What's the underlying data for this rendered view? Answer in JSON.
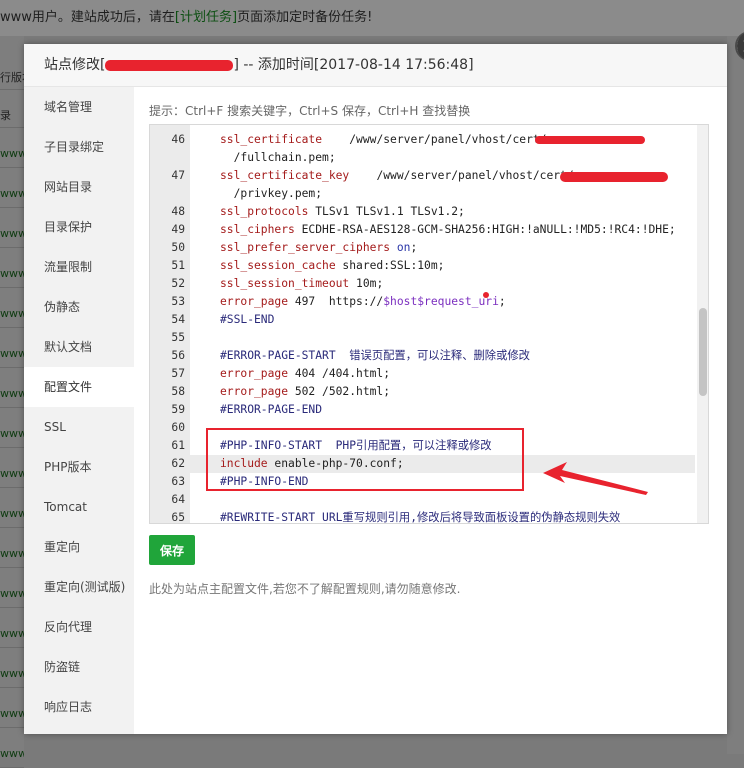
{
  "background": {
    "top_text_before": "www用户。建站成功后，请在",
    "top_link": "[计划任务]",
    "top_text_after": "页面添加定时备份任务!",
    "row_fragments": [
      "行版本",
      "录",
      "www/w",
      "www/w",
      "www/w",
      "www/w",
      "www/w",
      "www/w",
      "www/w",
      "www/w",
      "www/w",
      "www/w",
      "www/w",
      "www/w",
      "www/w",
      "www/w",
      "www/w",
      "www/w"
    ]
  },
  "dialog": {
    "title_prefix": "站点修改[",
    "title_suffix": "] -- 添加时间[2017-08-14 17:56:48]",
    "close_icon": "close-icon"
  },
  "sidebar": {
    "items": [
      {
        "label": "域名管理"
      },
      {
        "label": "子目录绑定"
      },
      {
        "label": "网站目录"
      },
      {
        "label": "目录保护"
      },
      {
        "label": "流量限制"
      },
      {
        "label": "伪静态"
      },
      {
        "label": "默认文档"
      },
      {
        "label": "配置文件",
        "active": true
      },
      {
        "label": "SSL"
      },
      {
        "label": "PHP版本"
      },
      {
        "label": "Tomcat"
      },
      {
        "label": "重定向"
      },
      {
        "label": "重定向(测试版)"
      },
      {
        "label": "反向代理"
      },
      {
        "label": "防盗链"
      },
      {
        "label": "响应日志"
      }
    ]
  },
  "editor": {
    "hint": "提示：Ctrl+F 搜索关键字，Ctrl+S 保存，Ctrl+H 查找替换",
    "lines": [
      {
        "n": "46",
        "text": "ssl_certificate    /www/server/panel/vhost/cert/"
      },
      {
        "n": "",
        "text": "  /fullchain.pem;"
      },
      {
        "n": "47",
        "text": "ssl_certificate_key    /www/server/panel/vhost/cert/"
      },
      {
        "n": "",
        "text": "  /privkey.pem;"
      },
      {
        "n": "48",
        "text": "ssl_protocols TLSv1 TLSv1.1 TLSv1.2;"
      },
      {
        "n": "49",
        "text": "ssl_ciphers ECDHE-RSA-AES128-GCM-SHA256:HIGH:!aNULL:!MD5:!RC4:!DHE;"
      },
      {
        "n": "50",
        "text": "ssl_prefer_server_ciphers on;"
      },
      {
        "n": "51",
        "text": "ssl_session_cache shared:SSL:10m;"
      },
      {
        "n": "52",
        "text": "ssl_session_timeout 10m;"
      },
      {
        "n": "53",
        "text": "error_page 497  https://$host$request_uri;"
      },
      {
        "n": "54",
        "text": "#SSL-END"
      },
      {
        "n": "55",
        "text": ""
      },
      {
        "n": "56",
        "text": "#ERROR-PAGE-START  错误页配置，可以注释、删除或修改"
      },
      {
        "n": "57",
        "text": "error_page 404 /404.html;"
      },
      {
        "n": "58",
        "text": "error_page 502 /502.html;"
      },
      {
        "n": "59",
        "text": "#ERROR-PAGE-END"
      },
      {
        "n": "60",
        "text": ""
      },
      {
        "n": "61",
        "text": "#PHP-INFO-START  PHP引用配置，可以注释或修改"
      },
      {
        "n": "62",
        "text": "include enable-php-70.conf;"
      },
      {
        "n": "63",
        "text": "#PHP-INFO-END"
      },
      {
        "n": "64",
        "text": ""
      },
      {
        "n": "65",
        "text": "#REWRITE-START URL重写规则引用,修改后将导致面板设置的伪静态规则失效"
      }
    ]
  },
  "actions": {
    "save_label": "保存",
    "note": "此处为站点主配置文件,若您不了解配置规则,请勿随意修改."
  },
  "colors": {
    "accent": "#20a53a",
    "annotation": "#e8232e"
  }
}
